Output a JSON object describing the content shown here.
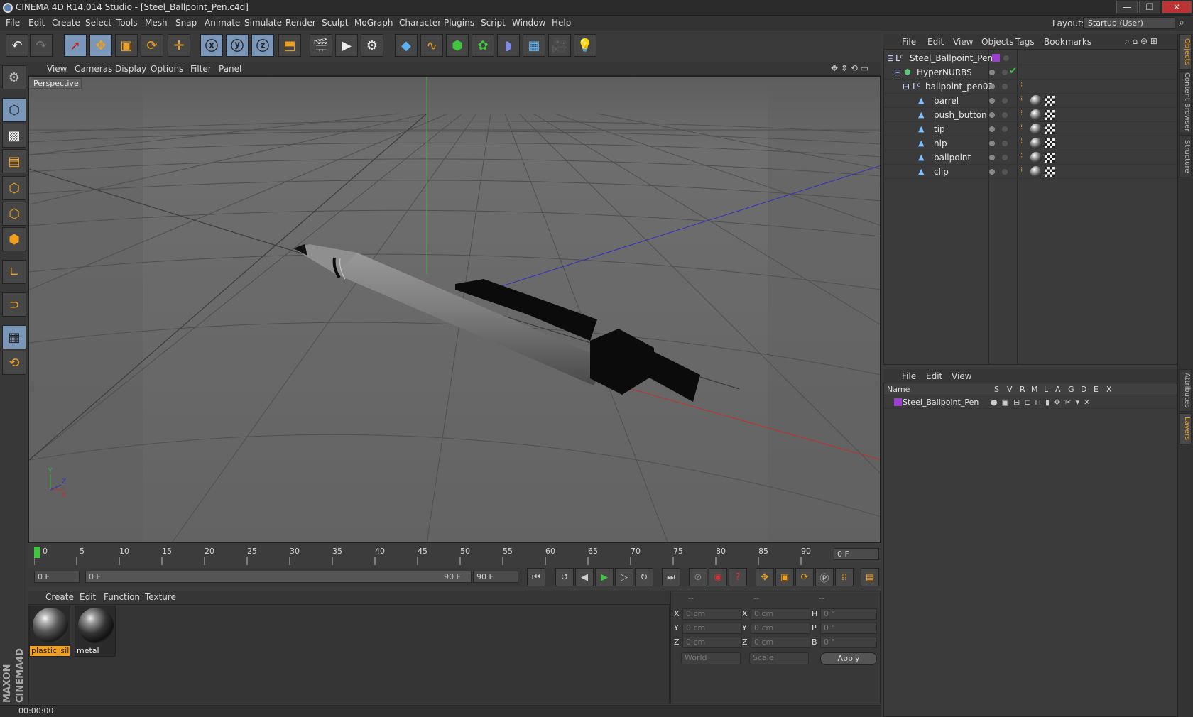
{
  "window": {
    "title": "CINEMA 4D R14.014 Studio - [Steel_Ballpoint_Pen.c4d]",
    "minimize": "—",
    "maximize": "❐",
    "close": "✕"
  },
  "menu": [
    "File",
    "Edit",
    "Create",
    "Select",
    "Tools",
    "Mesh",
    "Snap",
    "Animate",
    "Simulate",
    "Render",
    "Sculpt",
    "MoGraph",
    "Character",
    "Plugins",
    "Script",
    "Window",
    "Help"
  ],
  "layout": {
    "label": "Layout:",
    "value": "Startup (User)"
  },
  "viewport": {
    "menu": [
      "View",
      "Cameras",
      "Display",
      "Options",
      "Filter",
      "Panel"
    ],
    "label": "Perspective"
  },
  "timeline": {
    "ticks": [
      "0",
      "5",
      "10",
      "15",
      "20",
      "25",
      "30",
      "35",
      "40",
      "45",
      "50",
      "55",
      "60",
      "65",
      "70",
      "75",
      "80",
      "85",
      "90"
    ],
    "current_frame": "0 F",
    "start": "0 F",
    "range_start": "0 F",
    "range_end": "90 F",
    "end": "90 F"
  },
  "materials": {
    "menu": [
      "Create",
      "Edit",
      "Function",
      "Texture"
    ],
    "items": [
      {
        "name": "plastic_silv",
        "selected": true
      },
      {
        "name": "metal",
        "selected": false
      }
    ]
  },
  "coordinates": {
    "headers": [
      "--",
      "--",
      "--"
    ],
    "rows": [
      {
        "a": "X",
        "av": "0 cm",
        "b": "X",
        "bv": "0 cm",
        "c": "H",
        "cv": "0 °"
      },
      {
        "a": "Y",
        "av": "0 cm",
        "b": "Y",
        "bv": "0 cm",
        "c": "P",
        "cv": "0 °"
      },
      {
        "a": "Z",
        "av": "0 cm",
        "b": "Z",
        "bv": "0 cm",
        "c": "B",
        "cv": "0 °"
      }
    ],
    "mode": "World",
    "transform": "Scale",
    "apply": "Apply"
  },
  "status": {
    "time": "00:00:00"
  },
  "objects": {
    "menu": [
      "File",
      "Edit",
      "View",
      "Objects",
      "Tags",
      "Bookmarks"
    ],
    "tree": [
      {
        "name": "Steel_Ballpoint_Pen",
        "icon": "null",
        "depth": 0
      },
      {
        "name": "HyperNURBS",
        "icon": "nurbs",
        "depth": 1
      },
      {
        "name": "ballpoint_pen02",
        "icon": "null",
        "depth": 2
      },
      {
        "name": "barrel",
        "icon": "poly",
        "depth": 3
      },
      {
        "name": "push_button",
        "icon": "poly",
        "depth": 3
      },
      {
        "name": "tip",
        "icon": "poly",
        "depth": 3
      },
      {
        "name": "nip",
        "icon": "poly",
        "depth": 3
      },
      {
        "name": "ballpoint",
        "icon": "poly",
        "depth": 3
      },
      {
        "name": "clip",
        "icon": "poly",
        "depth": 3
      }
    ]
  },
  "layers": {
    "menu": [
      "File",
      "Edit",
      "View"
    ],
    "headers": [
      "Name",
      "S",
      "V",
      "R",
      "M",
      "L",
      "A",
      "G",
      "D",
      "E",
      "X"
    ],
    "rows": [
      {
        "name": "Steel_Ballpoint_Pen"
      }
    ],
    "layer_color": "#9b3fd0"
  },
  "side_tabs": [
    "Objects",
    "Content Browser",
    "Structure",
    "Attributes",
    "Layers"
  ],
  "colors": {
    "accent": "#f0a020",
    "active_tool": "#7a96b8",
    "x_axis": "#c03030",
    "y_axis": "#30b030",
    "z_axis": "#3030c0"
  }
}
